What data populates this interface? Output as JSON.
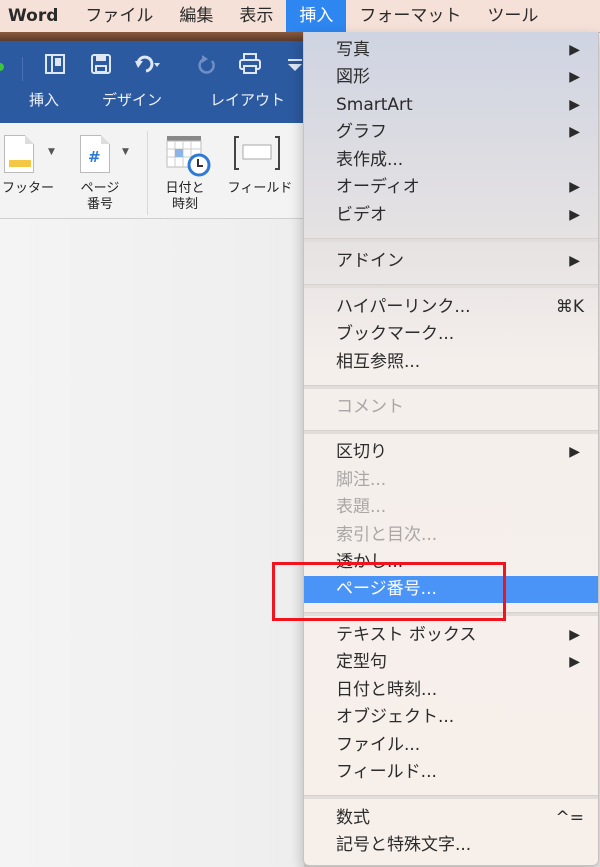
{
  "menubar": {
    "app": "Word",
    "items": [
      "ファイル",
      "編集",
      "表示",
      "挿入",
      "フォーマット",
      "ツール"
    ],
    "active_index": 3
  },
  "ribbon": {
    "quick_access": [
      "sidebar-icon",
      "save-icon",
      "undo-icon",
      "redo-icon",
      "print-icon",
      "customize-icon"
    ],
    "tabs": [
      "挿入",
      "デザイン",
      "レイアウト"
    ],
    "buttons": {
      "footer": "フッター",
      "page_number_line1": "ページ",
      "page_number_line2": "番号",
      "date_time_line1": "日付と",
      "date_time_line2": "時刻",
      "field": "フィールド"
    }
  },
  "menu": {
    "items": [
      {
        "label": "写真",
        "submenu": true
      },
      {
        "label": "図形",
        "submenu": true
      },
      {
        "label": "SmartArt",
        "submenu": true
      },
      {
        "label": "グラフ",
        "submenu": true
      },
      {
        "label": "表作成...",
        "submenu": false
      },
      {
        "label": "オーディオ",
        "submenu": true
      },
      {
        "label": "ビデオ",
        "submenu": true
      },
      {
        "label": "アドイン",
        "submenu": true
      },
      {
        "label": "ハイパーリンク...",
        "shortcut": "⌘K"
      },
      {
        "label": "ブックマーク..."
      },
      {
        "label": "相互参照..."
      },
      {
        "label": "コメント",
        "disabled": true
      },
      {
        "label": "区切り",
        "submenu": true
      },
      {
        "label": "脚注...",
        "disabled": true
      },
      {
        "label": "表題...",
        "disabled": true
      },
      {
        "label": "索引と目次...",
        "disabled": true
      },
      {
        "label": "透かし..."
      },
      {
        "label": "ページ番号...",
        "highlighted": true
      },
      {
        "label": "テキスト ボックス",
        "submenu": true
      },
      {
        "label": "定型句",
        "submenu": true
      },
      {
        "label": "日付と時刻..."
      },
      {
        "label": "オブジェクト..."
      },
      {
        "label": "ファイル..."
      },
      {
        "label": "フィールド..."
      },
      {
        "label": "数式",
        "shortcut": "^="
      },
      {
        "label": "記号と特殊文字..."
      }
    ],
    "submenu_arrow": "▶"
  },
  "annotation": {
    "color": "#f0141e",
    "target": "ページ番号..."
  },
  "colors": {
    "highlight": "#4a93f7",
    "active_menu": "#2e86f0",
    "ribbon": "#2c5aa0"
  }
}
